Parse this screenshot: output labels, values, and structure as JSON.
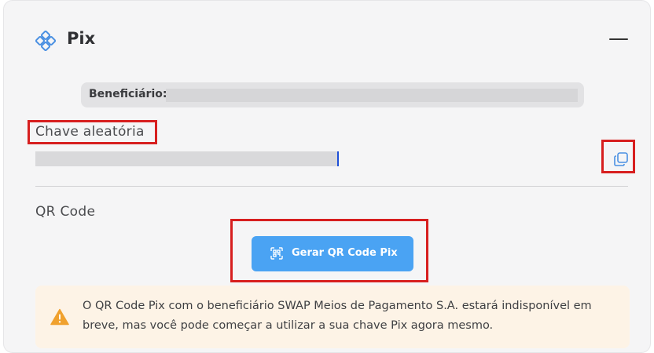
{
  "section": {
    "title": "Pix"
  },
  "beneficiary": {
    "label": "Beneficiário:"
  },
  "pix_key": {
    "label": "Chave aleatória"
  },
  "qr_code": {
    "label": "QR Code",
    "button_label": "Gerar QR Code Pix"
  },
  "warning": {
    "text": "O QR Code Pix com o beneficiário SWAP Meios de Pagamento S.A. estará indisponível em breve, mas você pode começar a utilizar a sua chave Pix agora mesmo."
  },
  "icons": {
    "header": "pix-icon",
    "collapse": "minus-icon",
    "copy": "copy-icon",
    "qr_button": "qr-code-icon",
    "warning": "warning-icon"
  },
  "colors": {
    "accent": "#4aa3f3",
    "highlight": "#d71f1f",
    "warning_bg": "#fdf3e6",
    "warning_icon": "#f0a12e"
  }
}
